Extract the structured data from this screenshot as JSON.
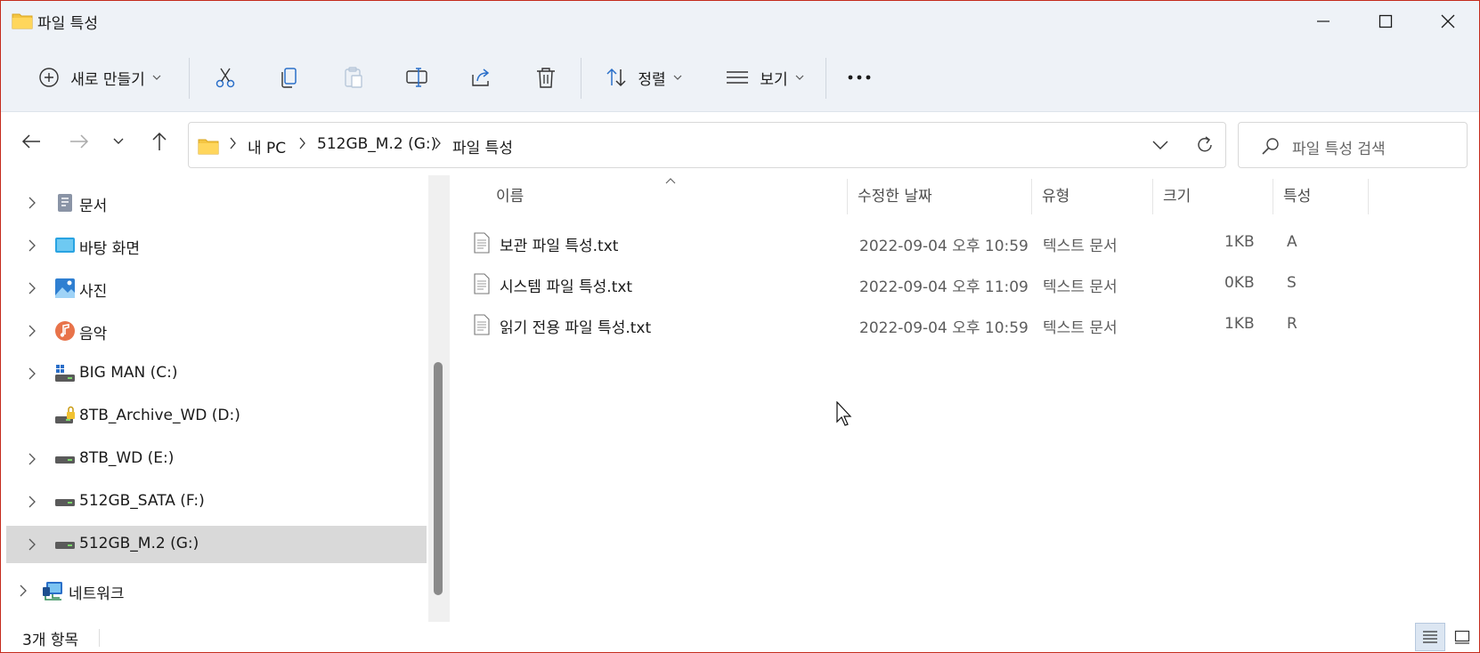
{
  "window": {
    "title": "파일 특성",
    "accent_color": "#c42b1c"
  },
  "toolbar": {
    "new_label": "새로 만들기",
    "sort_label": "정렬",
    "view_label": "보기",
    "icons": [
      "cut-icon",
      "copy-icon",
      "paste-icon",
      "rename-icon",
      "share-icon",
      "delete-icon",
      "more-icon"
    ]
  },
  "address": {
    "crumbs": [
      "내 PC",
      "512GB_M.2 (G:)",
      "파일 특성"
    ]
  },
  "search": {
    "placeholder": "파일 특성 검색"
  },
  "nav": {
    "items": [
      {
        "label": "문서",
        "icon": "documents-icon",
        "expandable": true,
        "selected": false
      },
      {
        "label": "바탕 화면",
        "icon": "desktop-icon",
        "expandable": true,
        "selected": false
      },
      {
        "label": "사진",
        "icon": "pictures-icon",
        "expandable": true,
        "selected": false
      },
      {
        "label": "음악",
        "icon": "music-icon",
        "expandable": true,
        "selected": false
      },
      {
        "label": "BIG MAN (C:)",
        "icon": "system-drive-icon",
        "expandable": true,
        "selected": false
      },
      {
        "label": "8TB_Archive_WD (D:)",
        "icon": "locked-drive-icon",
        "expandable": false,
        "selected": false
      },
      {
        "label": "8TB_WD (E:)",
        "icon": "drive-icon",
        "expandable": true,
        "selected": false
      },
      {
        "label": "512GB_SATA (F:)",
        "icon": "drive-icon",
        "expandable": true,
        "selected": false
      },
      {
        "label": "512GB_M.2 (G:)",
        "icon": "drive-icon",
        "expandable": true,
        "selected": true
      },
      {
        "label": "네트워크",
        "icon": "network-icon",
        "expandable": true,
        "selected": false
      }
    ]
  },
  "columns": {
    "name": "이름",
    "modified": "수정한 날짜",
    "type": "유형",
    "size": "크기",
    "attributes": "특성"
  },
  "files": [
    {
      "name": "보관 파일 특성.txt",
      "modified": "2022-09-04 오후 10:59",
      "type": "텍스트 문서",
      "size": "1KB",
      "attr": "A"
    },
    {
      "name": "시스템 파일 특성.txt",
      "modified": "2022-09-04 오후 11:09",
      "type": "텍스트 문서",
      "size": "0KB",
      "attr": "S"
    },
    {
      "name": "읽기 전용 파일 특성.txt",
      "modified": "2022-09-04 오후 10:59",
      "type": "텍스트 문서",
      "size": "1KB",
      "attr": "R"
    }
  ],
  "status": {
    "item_count": "3개 항목"
  }
}
